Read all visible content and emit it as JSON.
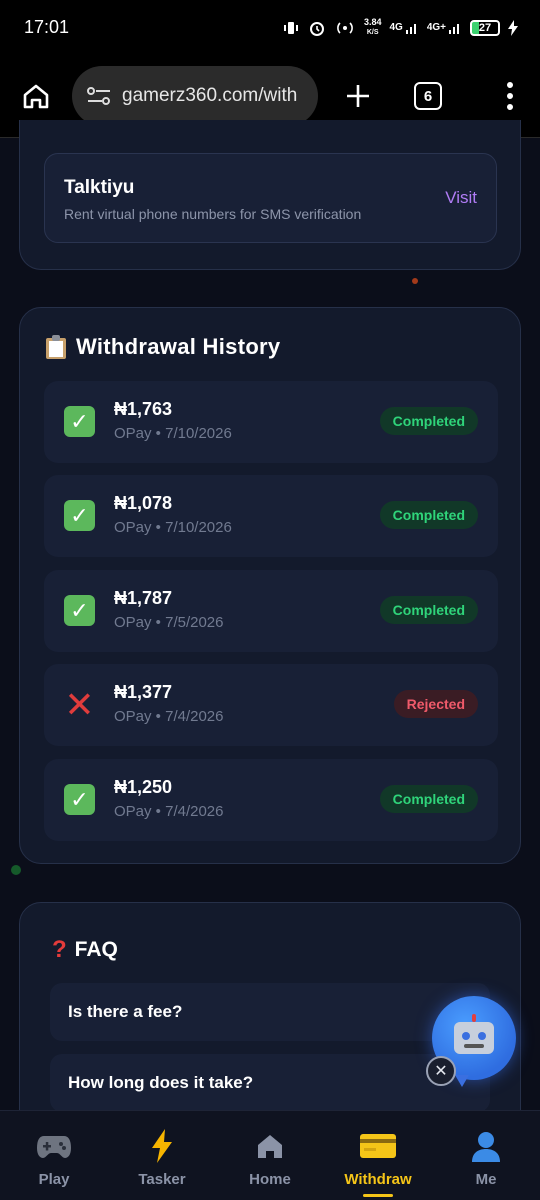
{
  "status_bar": {
    "time": "17:01",
    "net_speed_value": "3.84",
    "net_speed_unit": "K/S",
    "signal_1": "4G",
    "signal_2": "4G+",
    "battery": "27"
  },
  "browser": {
    "url": "gamerz360.com/with",
    "tab_count": "6"
  },
  "partner": {
    "name": "Talktiyu",
    "description": "Rent virtual phone numbers for SMS verification",
    "action": "Visit"
  },
  "history": {
    "title": "Withdrawal History",
    "items": [
      {
        "amount": "₦1,763",
        "meta": "OPay • 7/10/2026",
        "status": "Completed",
        "ok": true
      },
      {
        "amount": "₦1,078",
        "meta": "OPay • 7/10/2026",
        "status": "Completed",
        "ok": true
      },
      {
        "amount": "₦1,787",
        "meta": "OPay • 7/5/2026",
        "status": "Completed",
        "ok": true
      },
      {
        "amount": "₦1,377",
        "meta": "OPay • 7/4/2026",
        "status": "Rejected",
        "ok": false
      },
      {
        "amount": "₦1,250",
        "meta": "OPay • 7/4/2026",
        "status": "Completed",
        "ok": true
      }
    ]
  },
  "faq": {
    "title": "FAQ",
    "items": [
      {
        "question": "Is there a fee?"
      },
      {
        "question": "How long does it take?"
      }
    ]
  },
  "nav": {
    "items": [
      {
        "label": "Play",
        "icon": "gamepad-icon"
      },
      {
        "label": "Tasker",
        "icon": "lightning-icon"
      },
      {
        "label": "Home",
        "icon": "home-icon"
      },
      {
        "label": "Withdraw",
        "icon": "card-icon",
        "active": true
      },
      {
        "label": "Me",
        "icon": "user-icon"
      }
    ]
  },
  "colors": {
    "background": "#0b0e1a",
    "card": "#131a2c",
    "accent_active": "#f5c518",
    "completed": "#2fd47a",
    "rejected": "#ef5a6a",
    "visit": "#b07cf5"
  }
}
